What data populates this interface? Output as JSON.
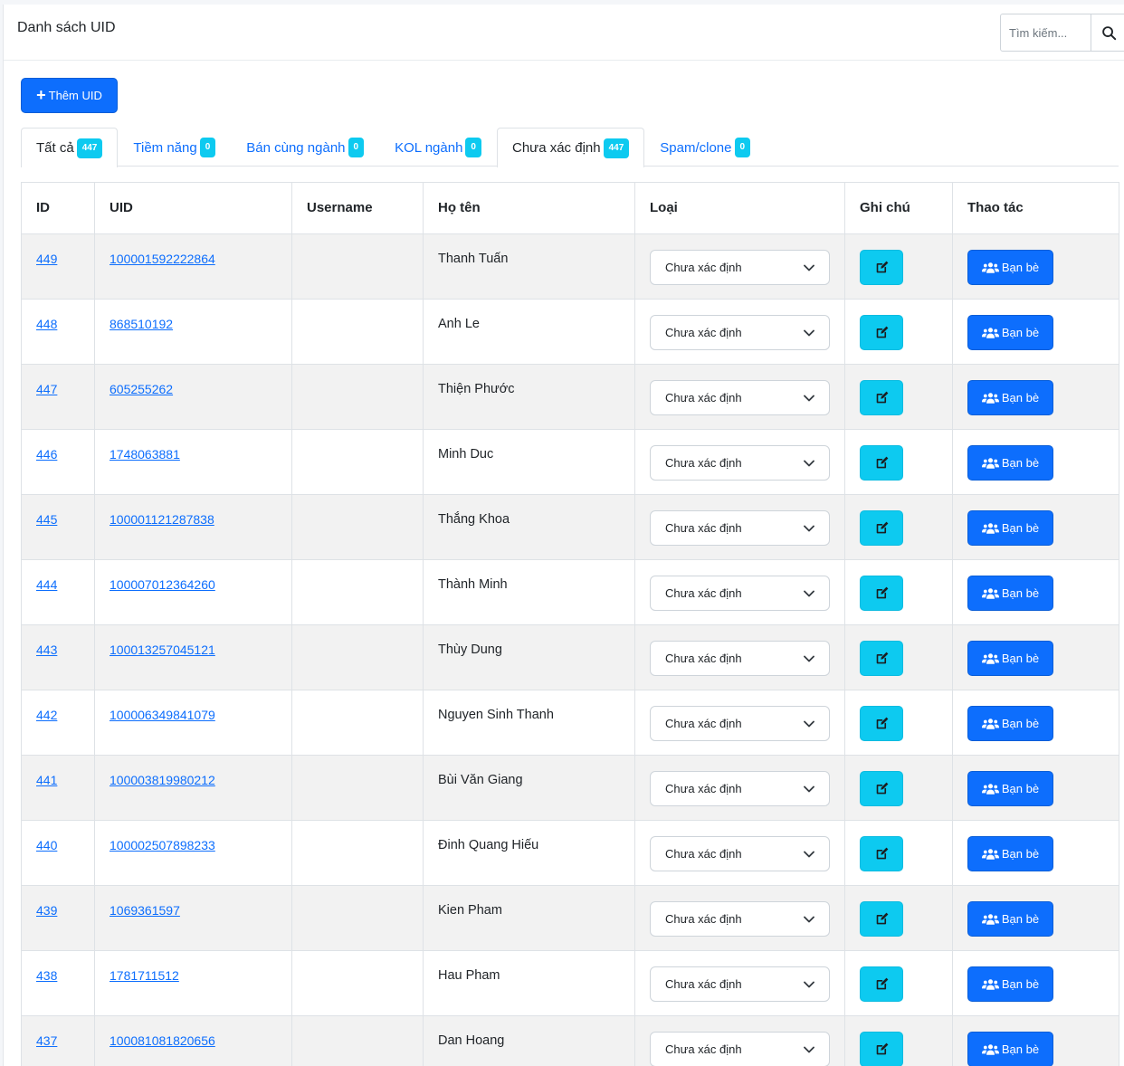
{
  "header": {
    "title": "Danh sách UID",
    "search_placeholder": "Tìm kiếm..."
  },
  "toolbar": {
    "add_label": "Thêm UID"
  },
  "tabs": [
    {
      "label": "Tất cả",
      "count": "447",
      "active": true
    },
    {
      "label": "Tiềm năng",
      "count": "0",
      "active": false
    },
    {
      "label": "Bán cùng ngành",
      "count": "0",
      "active": false
    },
    {
      "label": "KOL ngành",
      "count": "0",
      "active": false
    },
    {
      "label": "Chưa xác định",
      "count": "447",
      "active": true
    },
    {
      "label": "Spam/clone",
      "count": "0",
      "active": false
    }
  ],
  "table": {
    "columns": [
      "ID",
      "UID",
      "Username",
      "Họ tên",
      "Loại",
      "Ghi chú",
      "Thao tác"
    ],
    "type_label": "Chưa xác định",
    "friends_label": "Bạn bè",
    "rows": [
      {
        "id": "449",
        "uid": "100001592222864",
        "username": "",
        "name": "Thanh Tuấn"
      },
      {
        "id": "448",
        "uid": "868510192",
        "username": "",
        "name": "Anh Le"
      },
      {
        "id": "447",
        "uid": "605255262",
        "username": "",
        "name": "Thiện Phước"
      },
      {
        "id": "446",
        "uid": "1748063881",
        "username": "",
        "name": "Minh Duc"
      },
      {
        "id": "445",
        "uid": "100001121287838",
        "username": "",
        "name": "Thắng Khoa"
      },
      {
        "id": "444",
        "uid": "100007012364260",
        "username": "",
        "name": "Thành Minh"
      },
      {
        "id": "443",
        "uid": "100013257045121",
        "username": "",
        "name": "Thùy Dung"
      },
      {
        "id": "442",
        "uid": "100006349841079",
        "username": "",
        "name": "Nguyen Sinh Thanh"
      },
      {
        "id": "441",
        "uid": "100003819980212",
        "username": "",
        "name": "Bùi Văn Giang"
      },
      {
        "id": "440",
        "uid": "100002507898233",
        "username": "",
        "name": "Đinh Quang Hiếu"
      },
      {
        "id": "439",
        "uid": "1069361597",
        "username": "",
        "name": "Kien Pham"
      },
      {
        "id": "438",
        "uid": "1781711512",
        "username": "",
        "name": "Hau Pham"
      },
      {
        "id": "437",
        "uid": "100081081820656",
        "username": "",
        "name": "Dan Hoang"
      }
    ]
  },
  "icons": {
    "search": "search-icon",
    "add": "plus-icon",
    "select": "chevron-down-icon",
    "note": "edit-icon",
    "friends": "users-icon"
  },
  "colors": {
    "primary": "#0d6efd",
    "info": "#0dcaf0"
  }
}
